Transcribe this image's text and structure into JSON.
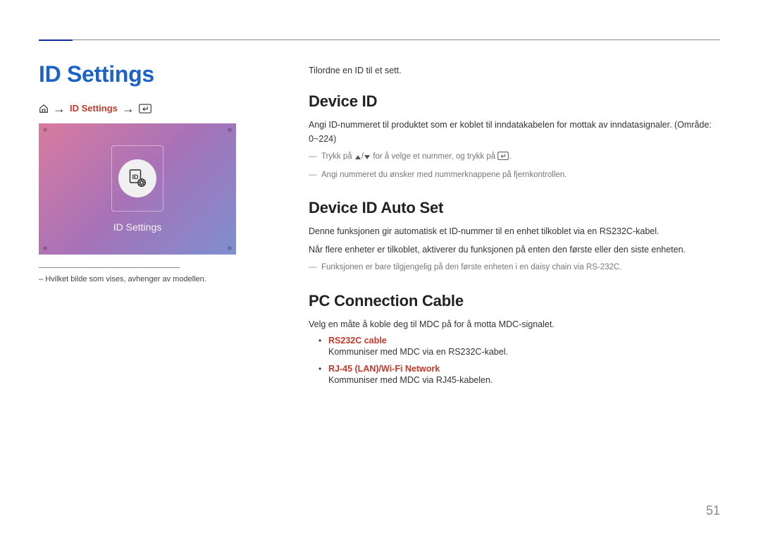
{
  "title": "ID Settings",
  "breadcrumb": {
    "id_settings": "ID Settings"
  },
  "screenshot_caption": "ID Settings",
  "footnote": "Hvilket bilde som vises, avhenger av modellen.",
  "intro": "Tilordne en ID til et sett.",
  "sections": {
    "device_id": {
      "heading": "Device ID",
      "body": "Angi ID-nummeret til produktet som er koblet til inndatakabelen for mottak av inndatasignaler. (Område: 0~224)",
      "note1_pre": "Trykk på ",
      "note1_mid": " for å velge et nummer, og trykk på ",
      "note1_post": ".",
      "note2": "Angi nummeret du ønsker med nummerknappene på fjernkontrollen."
    },
    "auto_set": {
      "heading": "Device ID Auto Set",
      "body1": "Denne funksjonen gir automatisk et ID-nummer til en enhet tilkoblet via en RS232C-kabel.",
      "body2": "Når flere enheter er tilkoblet, aktiverer du funksjonen på enten den første eller den siste enheten.",
      "note": "Funksjonen er bare tilgjengelig på den første enheten i en daisy chain via RS-232C."
    },
    "pc_cable": {
      "heading": "PC Connection Cable",
      "body": "Velg en måte å koble deg til MDC på for å motta MDC-signalet.",
      "items": [
        {
          "name": "RS232C cable",
          "desc": "Kommuniser med MDC via en RS232C-kabel."
        },
        {
          "name": "RJ-45 (LAN)/Wi-Fi Network",
          "desc": "Kommuniser med MDC via RJ45-kabelen."
        }
      ]
    }
  },
  "page_number": "51"
}
